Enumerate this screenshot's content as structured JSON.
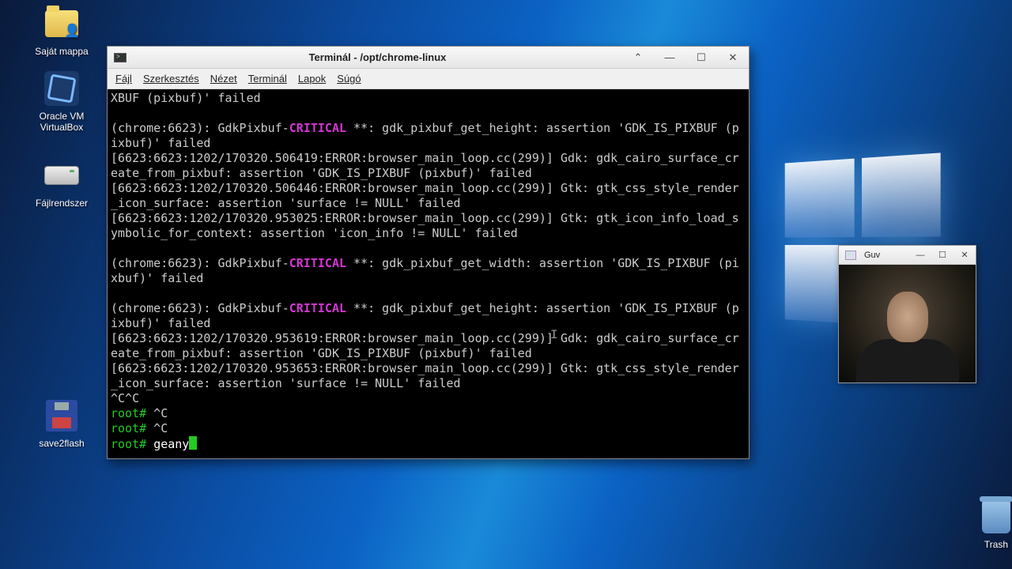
{
  "desktop": {
    "icons": {
      "home": "Saját mappa",
      "vbox1": "Oracle VM",
      "vbox2": "VirtualBox",
      "fs": "Fájlrendszer",
      "save": "save2flash",
      "trash": "Trash"
    }
  },
  "terminal": {
    "title": "Terminál - /opt/chrome-linux",
    "menus": {
      "file": "Fájl",
      "edit": "Szerkesztés",
      "view": "Nézet",
      "terminal": "Terminál",
      "tabs": "Lapok",
      "help": "Súgó"
    },
    "lines": [
      {
        "type": "plain",
        "text": "XBUF (pixbuf)' failed"
      },
      {
        "type": "blank"
      },
      {
        "type": "crit",
        "pre": "(chrome:6623): GdkPixbuf-",
        "crit": "CRITICAL",
        "post": " **: gdk_pixbuf_get_height: assertion 'GDK_IS_PIXBUF (pixbuf)' failed"
      },
      {
        "type": "plain",
        "text": "[6623:6623:1202/170320.506419:ERROR:browser_main_loop.cc(299)] Gdk: gdk_cairo_surface_create_from_pixbuf: assertion 'GDK_IS_PIXBUF (pixbuf)' failed"
      },
      {
        "type": "plain",
        "text": "[6623:6623:1202/170320.506446:ERROR:browser_main_loop.cc(299)] Gtk: gtk_css_style_render_icon_surface: assertion 'surface != NULL' failed"
      },
      {
        "type": "plain",
        "text": "[6623:6623:1202/170320.953025:ERROR:browser_main_loop.cc(299)] Gtk: gtk_icon_info_load_symbolic_for_context: assertion 'icon_info != NULL' failed"
      },
      {
        "type": "blank"
      },
      {
        "type": "crit",
        "pre": "(chrome:6623): GdkPixbuf-",
        "crit": "CRITICAL",
        "post": " **: gdk_pixbuf_get_width: assertion 'GDK_IS_PIXBUF (pixbuf)' failed"
      },
      {
        "type": "blank"
      },
      {
        "type": "crit",
        "pre": "(chrome:6623): GdkPixbuf-",
        "crit": "CRITICAL",
        "post": " **: gdk_pixbuf_get_height: assertion 'GDK_IS_PIXBUF (pixbuf)' failed"
      },
      {
        "type": "plain",
        "text": "[6623:6623:1202/170320.953619:ERROR:browser_main_loop.cc(299)] Gdk: gdk_cairo_surface_create_from_pixbuf: assertion 'GDK_IS_PIXBUF (pixbuf)' failed"
      },
      {
        "type": "plain",
        "text": "[6623:6623:1202/170320.953653:ERROR:browser_main_loop.cc(299)] Gtk: gtk_css_style_render_icon_surface: assertion 'surface != NULL' failed"
      },
      {
        "type": "plain",
        "text": "^C^C"
      },
      {
        "type": "prompt",
        "prompt": "root#",
        "text": " ^C"
      },
      {
        "type": "prompt",
        "prompt": "root#",
        "text": " ^C"
      },
      {
        "type": "promptcmd",
        "prompt": "root#",
        "text": " ",
        "cmd": "geany",
        "cursor": true
      }
    ]
  },
  "cam": {
    "title": "Guv"
  },
  "winbtns": {
    "up": "⌃",
    "min": "—",
    "max": "☐",
    "close": "✕"
  }
}
